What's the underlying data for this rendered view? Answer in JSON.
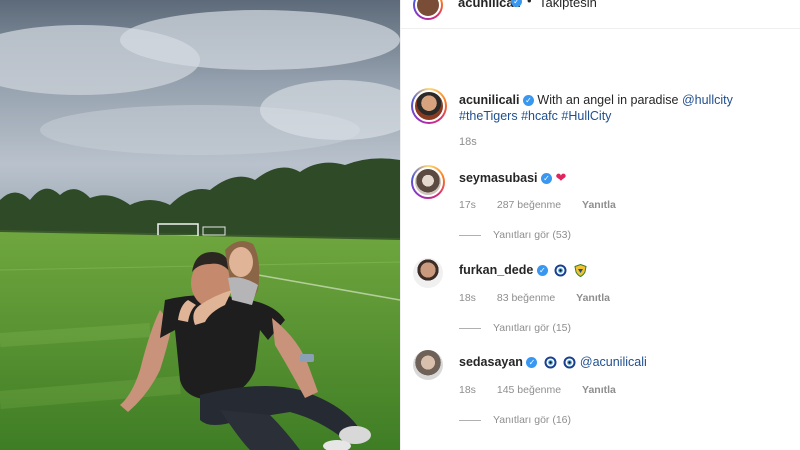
{
  "header": {
    "username": "acunilicali",
    "separator": "•",
    "follow_label": "Takiptesin"
  },
  "post": {
    "caption": {
      "username": "acunilicali",
      "text": "With an angel in paradise",
      "mention": "@hullcity",
      "hashtag1": "#theTigers",
      "hashtag2": "#hcafc",
      "hashtag3": "#HullCity",
      "time": "18s"
    }
  },
  "comments": [
    {
      "username": "seymasubasi",
      "content_icon": "heart-icon",
      "time": "17s",
      "likes": "287 beğenme",
      "reply_label": "Yanıtla",
      "view_replies": "Yanıtları gör (53)"
    },
    {
      "username": "furkan_dede",
      "content_icons": [
        "evil-eye-icon",
        "shield-icon"
      ],
      "time": "18s",
      "likes": "83 beğenme",
      "reply_label": "Yanıtla",
      "view_replies": "Yanıtları gör (15)"
    },
    {
      "username": "sedasayan",
      "content_icons": [
        "evil-eye-icon",
        "evil-eye-icon"
      ],
      "mention": "@acunilicali",
      "time": "18s",
      "likes": "145 beğenme",
      "reply_label": "Yanıtla",
      "view_replies": "Yanıtları gör (16)"
    }
  ],
  "colors": {
    "verified": "#3897f0",
    "heart": "#e0245e",
    "link": "#1f4f8f",
    "muted": "#8e8e8e"
  }
}
